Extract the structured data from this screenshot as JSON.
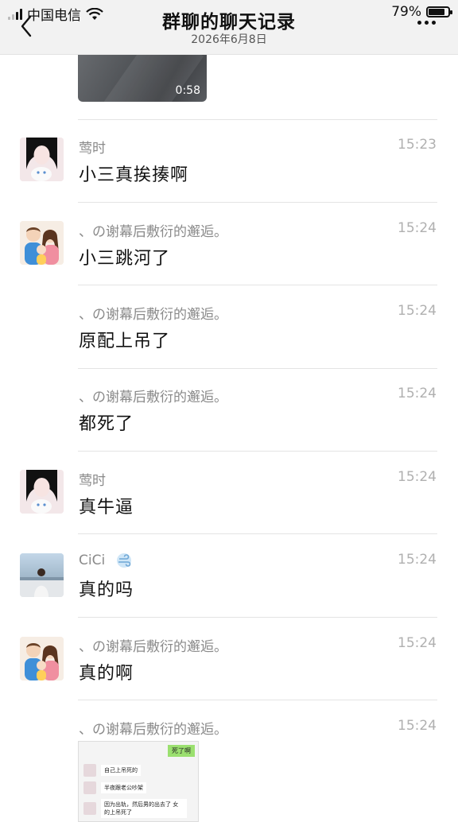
{
  "status": {
    "carrier": "中国电信",
    "battery": "79%"
  },
  "header": {
    "title": "群聊的聊天记录",
    "date": "2026年6月8日"
  },
  "video": {
    "duration": "0:58"
  },
  "messages": [
    {
      "sender": "莺时",
      "time": "15:23",
      "text": "小三真挨揍啊",
      "avatar": "girl-cat-avatar"
    },
    {
      "sender": "、の谢幕后敷衍的邂逅。",
      "time": "15:24",
      "text": "小三跳河了",
      "avatar": "family-avatar"
    },
    {
      "sender": "、の谢幕后敷衍的邂逅。",
      "time": "15:24",
      "text": "原配上吊了",
      "avatar": ""
    },
    {
      "sender": "、の谢幕后敷衍的邂逅。",
      "time": "15:24",
      "text": "都死了",
      "avatar": ""
    },
    {
      "sender": "莺时",
      "time": "15:24",
      "text": "真牛逼",
      "avatar": "girl-cat-avatar"
    },
    {
      "sender": "CiCi",
      "time": "15:24",
      "text": "真的吗",
      "avatar": "cici-avatar"
    },
    {
      "sender": "、の谢幕后敷衍的邂逅。",
      "time": "15:24",
      "text": "真的啊",
      "avatar": "family-avatar"
    },
    {
      "sender": "、の谢幕后敷衍的邂逅。",
      "time": "15:24",
      "text": "",
      "avatar": ""
    }
  ],
  "screenshot_preview": {
    "tag": "死了啊",
    "lines": [
      "自己上吊死的",
      "半夜跟老公吵架",
      "因为出轨，然后男的出去了 女的上吊死了"
    ]
  },
  "colors": {
    "header_bg": "#f2f2f2",
    "time": "#b0b0b0",
    "sender": "#8a8a8a",
    "divider": "#e4e4e4"
  }
}
